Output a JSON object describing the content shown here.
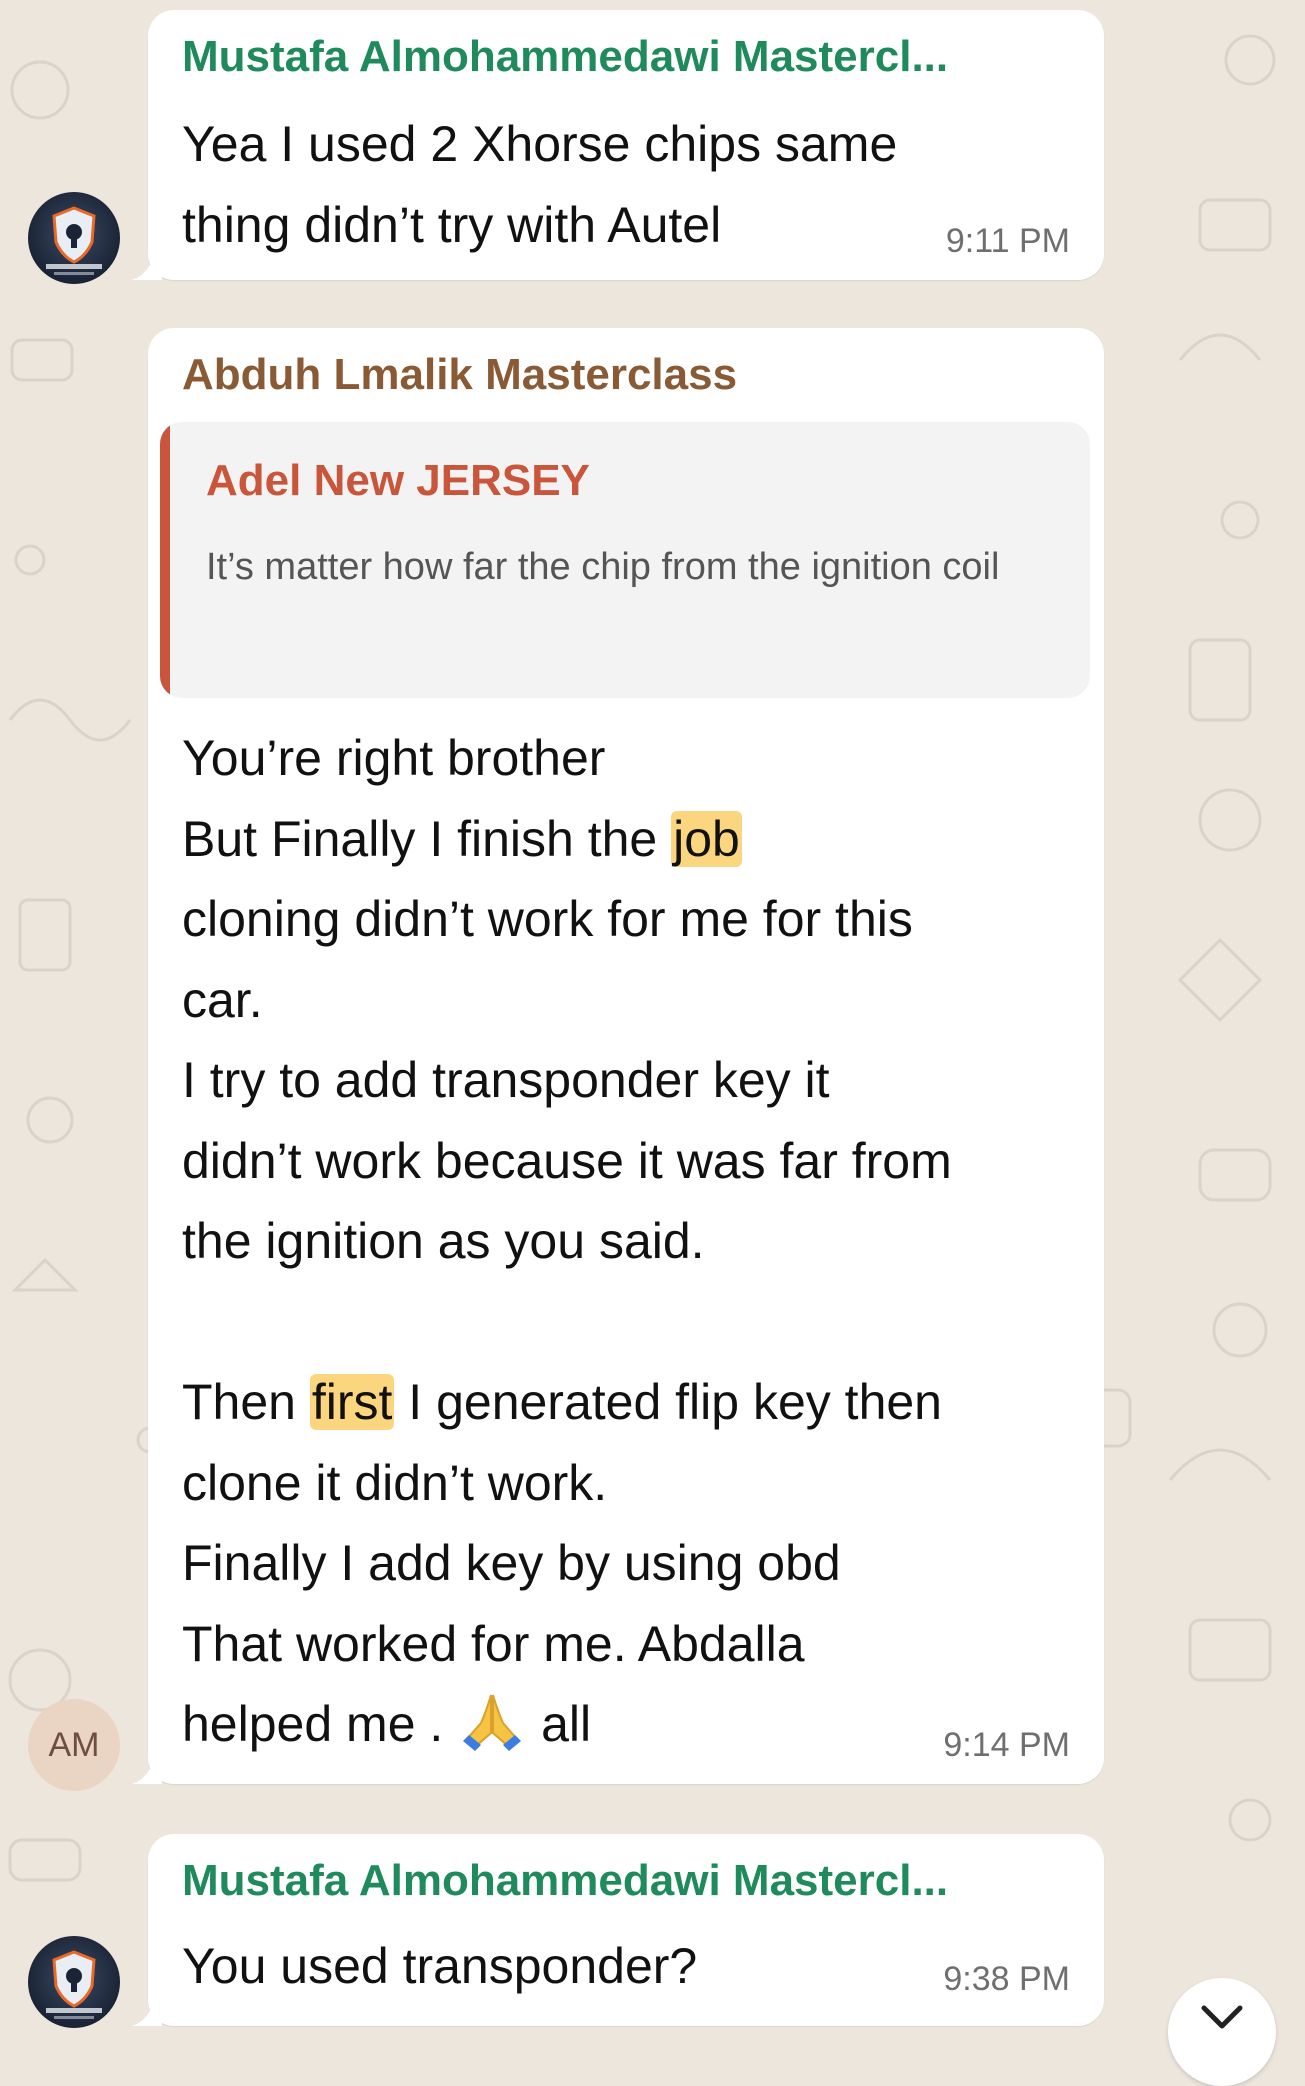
{
  "colors": {
    "background": "#ede6dd",
    "bubble": "#ffffff",
    "sender_green": "#1f8a5b",
    "sender_brown": "#8a5a35",
    "quote_accent": "#c9553a",
    "highlight": "#fcd57f"
  },
  "messages": [
    {
      "sender": "Mustafa Almohammedawi Mastercl...",
      "avatar": "ma-locksmith-logo",
      "lines": [
        "Yea I used 2 Xhorse chips same",
        "thing didn’t try with Autel"
      ],
      "time": "9:11 PM"
    },
    {
      "sender": "Abduh Lmalik Masterclass",
      "avatar_initials": "AM",
      "quote": {
        "author": "Adel New JERSEY",
        "text": "It’s matter how far the chip from the ignition coil"
      },
      "lines": [
        "You’re right brother",
        "But Finally I finish the ",
        "job",
        "cloning didn’t work for me for this",
        "car.",
        "I try to add transponder key it",
        "didn’t work because it was far from",
        "the ignition as you said.",
        "Then ",
        "first",
        " I generated flip key then",
        "clone it didn’t work.",
        "Finally I add key by using obd",
        "That worked for me. Abdalla",
        "helped me . ",
        " all"
      ],
      "emoji": "folded-hands-emoji",
      "time": "9:14 PM"
    },
    {
      "sender": "Mustafa Almohammedawi Mastercl...",
      "avatar": "ma-locksmith-logo",
      "lines": [
        "You used transponder?"
      ],
      "time": "9:38 PM"
    }
  ],
  "scroll_button": {
    "icon": "chevron-down-icon"
  }
}
